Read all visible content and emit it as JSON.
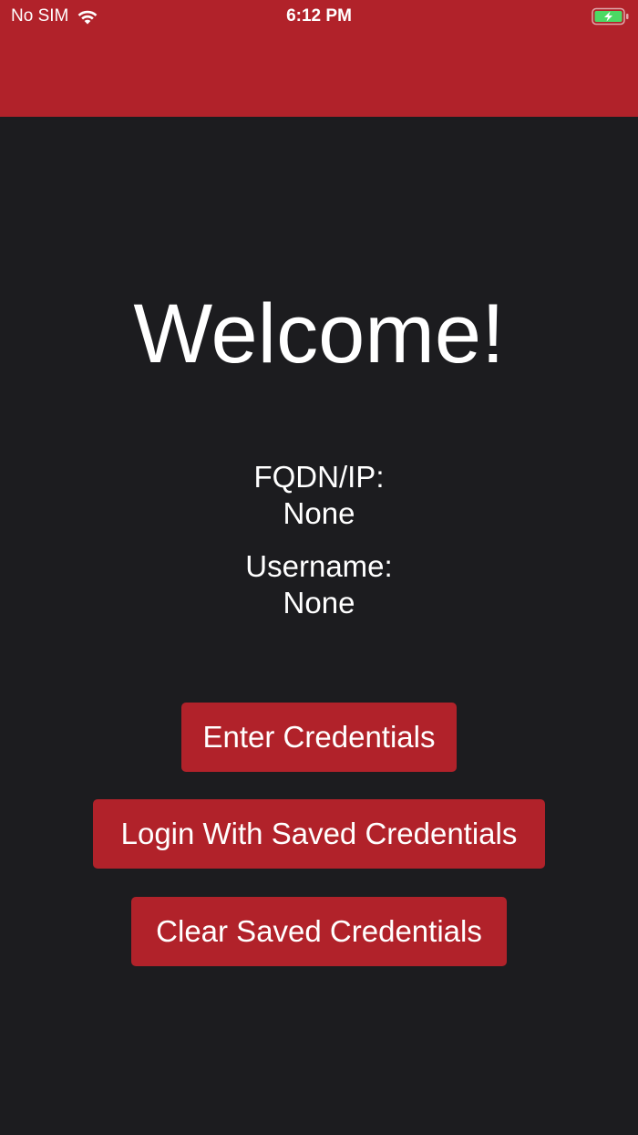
{
  "status_bar": {
    "carrier": "No SIM",
    "wifi_icon": "wifi-icon",
    "time": "6:12 PM",
    "battery_icon": "battery-charging-icon",
    "battery_color": "#4cd964"
  },
  "theme": {
    "accent": "#b1222a",
    "background": "#1c1c1f",
    "text": "#ffffff"
  },
  "main": {
    "welcome": "Welcome!",
    "fqdn_label": "FQDN/IP:",
    "fqdn_value": "None",
    "username_label": "Username:",
    "username_value": "None"
  },
  "buttons": {
    "enter_credentials": "Enter Credentials",
    "login_saved": "Login With Saved Credentials",
    "clear_saved": "Clear Saved Credentials"
  }
}
